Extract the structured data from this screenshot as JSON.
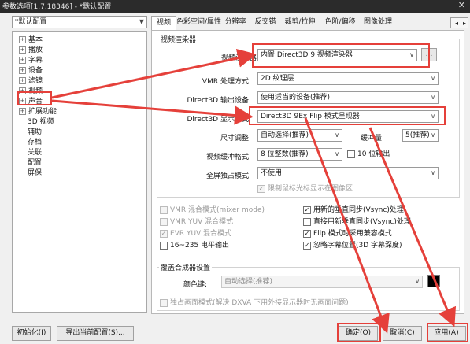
{
  "window": {
    "title": "参数选项[1.7.18346] - *默认配置",
    "close_glyph": "✕"
  },
  "profile_select": "*默认配置",
  "tree": [
    {
      "label": "基本",
      "expander": "+"
    },
    {
      "label": "播放",
      "expander": "+"
    },
    {
      "label": "字幕",
      "expander": "+"
    },
    {
      "label": "设备",
      "expander": "+"
    },
    {
      "label": "滤镜",
      "expander": "+"
    },
    {
      "label": "视频",
      "expander": "+"
    },
    {
      "label": "声音",
      "expander": "+"
    },
    {
      "label": "扩展功能",
      "expander": "+"
    },
    {
      "label": "3D 视频",
      "expander": ""
    },
    {
      "label": "辅助",
      "expander": ""
    },
    {
      "label": "存档",
      "expander": ""
    },
    {
      "label": "关联",
      "expander": ""
    },
    {
      "label": "配置",
      "expander": ""
    },
    {
      "label": "屏保",
      "expander": ""
    }
  ],
  "tabs": [
    "视频",
    "色彩空间/属性",
    "分辨率",
    "反交错",
    "裁剪/拉伸",
    "色阶/偏移",
    "图像处理"
  ],
  "tab_scroll": {
    "left": "◂",
    "right": "▸"
  },
  "renderer_group": {
    "title": "视频渲染器",
    "renderer_label": "视频渲染器:",
    "renderer_value": "内置 Direct3D 9 视频渲染器",
    "renderer_button": "...",
    "vmr_label": "VMR 处理方式:",
    "vmr_value": "2D 纹理层",
    "d3d_out_label": "Direct3D 输出设备:",
    "d3d_out_value": "使用适当的设备(推荐)",
    "d3d_display_label": "Direct3D 显示方式:",
    "d3d_display_value": "Direct3D 9Ex Flip 模式呈现器",
    "size_label": "尺寸调整:",
    "size_value": "自动选择(推荐)",
    "buffer_label": "缓冲量:",
    "buffer_value": "5(推荐)",
    "format_label": "视频缓冲格式:",
    "format_value": "8 位整数(推荐)",
    "tenbit_label": "10 位输出",
    "fullscreen_label": "全屏独占模式:",
    "fullscreen_value": "不使用",
    "cursor_label": "限制鼠标光标显示在图像区"
  },
  "options": [
    {
      "label": "VMR 混合模式(mixer mode)",
      "checked": false,
      "disabled": true
    },
    {
      "label": "用新的垂直同步(Vsync)处理",
      "checked": true,
      "disabled": false
    },
    {
      "label": "VMR YUV 混合模式",
      "checked": false,
      "disabled": true
    },
    {
      "label": "直接用新垂直同步(Vsync)处理",
      "checked": false,
      "disabled": false
    },
    {
      "label": "EVR YUV 混合模式",
      "checked": true,
      "disabled": true
    },
    {
      "label": "Flip 模式时采用兼容模式",
      "checked": true,
      "disabled": false
    },
    {
      "label": "16~235 电平输出",
      "checked": false,
      "disabled": false
    },
    {
      "label": "忽略字幕位置(3D 字幕深度)",
      "checked": true,
      "disabled": false
    }
  ],
  "overlay_group": {
    "title": "覆盖合成器设置",
    "color_key_label": "颜色键:",
    "color_key_value": "自动选择(推荐)",
    "color_swatch": "#000000",
    "exclusive_label": "独占画面模式(解决 DXVA 下用外接显示器时无画面问题)"
  },
  "footer": {
    "init_btn": "初始化(I)",
    "export_btn": "导出当前配置(S)...",
    "ok_btn": "确定(O)",
    "cancel_btn": "取消(C)",
    "apply_btn": "应用(A)"
  },
  "colors": {
    "annotation": "#e5403a",
    "titlebar": "#2b2b2b"
  }
}
